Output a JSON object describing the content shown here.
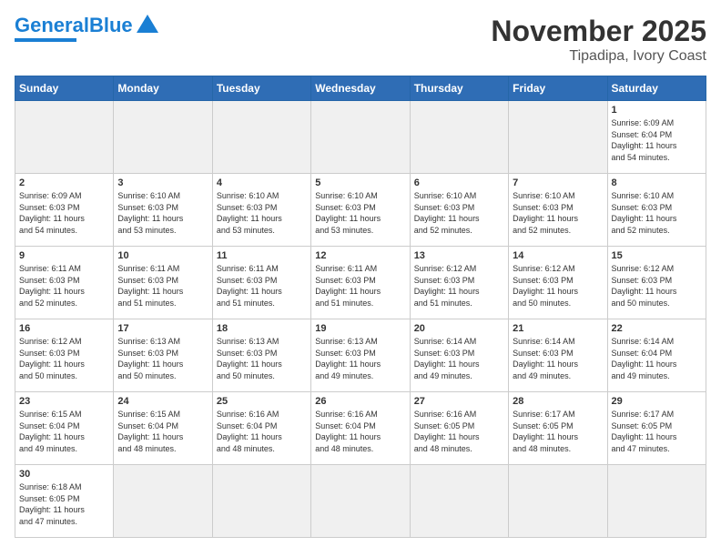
{
  "header": {
    "logo_general": "General",
    "logo_blue": "Blue",
    "month": "November 2025",
    "location": "Tipadipa, Ivory Coast"
  },
  "days_of_week": [
    "Sunday",
    "Monday",
    "Tuesday",
    "Wednesday",
    "Thursday",
    "Friday",
    "Saturday"
  ],
  "weeks": [
    [
      {
        "day": "",
        "info": ""
      },
      {
        "day": "",
        "info": ""
      },
      {
        "day": "",
        "info": ""
      },
      {
        "day": "",
        "info": ""
      },
      {
        "day": "",
        "info": ""
      },
      {
        "day": "",
        "info": ""
      },
      {
        "day": "1",
        "info": "Sunrise: 6:09 AM\nSunset: 6:04 PM\nDaylight: 11 hours\nand 54 minutes."
      }
    ],
    [
      {
        "day": "2",
        "info": "Sunrise: 6:09 AM\nSunset: 6:03 PM\nDaylight: 11 hours\nand 54 minutes."
      },
      {
        "day": "3",
        "info": "Sunrise: 6:10 AM\nSunset: 6:03 PM\nDaylight: 11 hours\nand 53 minutes."
      },
      {
        "day": "4",
        "info": "Sunrise: 6:10 AM\nSunset: 6:03 PM\nDaylight: 11 hours\nand 53 minutes."
      },
      {
        "day": "5",
        "info": "Sunrise: 6:10 AM\nSunset: 6:03 PM\nDaylight: 11 hours\nand 53 minutes."
      },
      {
        "day": "6",
        "info": "Sunrise: 6:10 AM\nSunset: 6:03 PM\nDaylight: 11 hours\nand 52 minutes."
      },
      {
        "day": "7",
        "info": "Sunrise: 6:10 AM\nSunset: 6:03 PM\nDaylight: 11 hours\nand 52 minutes."
      },
      {
        "day": "8",
        "info": "Sunrise: 6:10 AM\nSunset: 6:03 PM\nDaylight: 11 hours\nand 52 minutes."
      }
    ],
    [
      {
        "day": "9",
        "info": "Sunrise: 6:11 AM\nSunset: 6:03 PM\nDaylight: 11 hours\nand 52 minutes."
      },
      {
        "day": "10",
        "info": "Sunrise: 6:11 AM\nSunset: 6:03 PM\nDaylight: 11 hours\nand 51 minutes."
      },
      {
        "day": "11",
        "info": "Sunrise: 6:11 AM\nSunset: 6:03 PM\nDaylight: 11 hours\nand 51 minutes."
      },
      {
        "day": "12",
        "info": "Sunrise: 6:11 AM\nSunset: 6:03 PM\nDaylight: 11 hours\nand 51 minutes."
      },
      {
        "day": "13",
        "info": "Sunrise: 6:12 AM\nSunset: 6:03 PM\nDaylight: 11 hours\nand 51 minutes."
      },
      {
        "day": "14",
        "info": "Sunrise: 6:12 AM\nSunset: 6:03 PM\nDaylight: 11 hours\nand 50 minutes."
      },
      {
        "day": "15",
        "info": "Sunrise: 6:12 AM\nSunset: 6:03 PM\nDaylight: 11 hours\nand 50 minutes."
      }
    ],
    [
      {
        "day": "16",
        "info": "Sunrise: 6:12 AM\nSunset: 6:03 PM\nDaylight: 11 hours\nand 50 minutes."
      },
      {
        "day": "17",
        "info": "Sunrise: 6:13 AM\nSunset: 6:03 PM\nDaylight: 11 hours\nand 50 minutes."
      },
      {
        "day": "18",
        "info": "Sunrise: 6:13 AM\nSunset: 6:03 PM\nDaylight: 11 hours\nand 50 minutes."
      },
      {
        "day": "19",
        "info": "Sunrise: 6:13 AM\nSunset: 6:03 PM\nDaylight: 11 hours\nand 49 minutes."
      },
      {
        "day": "20",
        "info": "Sunrise: 6:14 AM\nSunset: 6:03 PM\nDaylight: 11 hours\nand 49 minutes."
      },
      {
        "day": "21",
        "info": "Sunrise: 6:14 AM\nSunset: 6:03 PM\nDaylight: 11 hours\nand 49 minutes."
      },
      {
        "day": "22",
        "info": "Sunrise: 6:14 AM\nSunset: 6:04 PM\nDaylight: 11 hours\nand 49 minutes."
      }
    ],
    [
      {
        "day": "23",
        "info": "Sunrise: 6:15 AM\nSunset: 6:04 PM\nDaylight: 11 hours\nand 49 minutes."
      },
      {
        "day": "24",
        "info": "Sunrise: 6:15 AM\nSunset: 6:04 PM\nDaylight: 11 hours\nand 48 minutes."
      },
      {
        "day": "25",
        "info": "Sunrise: 6:16 AM\nSunset: 6:04 PM\nDaylight: 11 hours\nand 48 minutes."
      },
      {
        "day": "26",
        "info": "Sunrise: 6:16 AM\nSunset: 6:04 PM\nDaylight: 11 hours\nand 48 minutes."
      },
      {
        "day": "27",
        "info": "Sunrise: 6:16 AM\nSunset: 6:05 PM\nDaylight: 11 hours\nand 48 minutes."
      },
      {
        "day": "28",
        "info": "Sunrise: 6:17 AM\nSunset: 6:05 PM\nDaylight: 11 hours\nand 48 minutes."
      },
      {
        "day": "29",
        "info": "Sunrise: 6:17 AM\nSunset: 6:05 PM\nDaylight: 11 hours\nand 47 minutes."
      }
    ],
    [
      {
        "day": "30",
        "info": "Sunrise: 6:18 AM\nSunset: 6:05 PM\nDaylight: 11 hours\nand 47 minutes."
      },
      {
        "day": "",
        "info": ""
      },
      {
        "day": "",
        "info": ""
      },
      {
        "day": "",
        "info": ""
      },
      {
        "day": "",
        "info": ""
      },
      {
        "day": "",
        "info": ""
      },
      {
        "day": "",
        "info": ""
      }
    ]
  ]
}
